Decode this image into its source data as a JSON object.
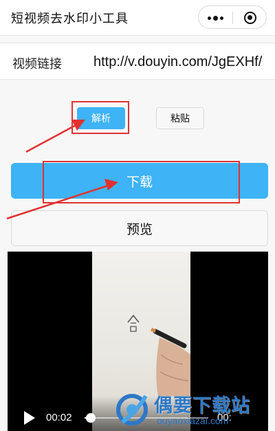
{
  "window": {
    "title": "短视频去水印小工具"
  },
  "capsule": {
    "more_icon": "more-dots-icon",
    "close_icon": "target-close-icon"
  },
  "link_row": {
    "label": "视频链接",
    "value": "http://v.douyin.com/JgEXHf/"
  },
  "buttons": {
    "parse": "解析",
    "paste": "粘贴",
    "download": "下载",
    "preview": "预览"
  },
  "video": {
    "current_time": "00:02",
    "total_time": "00:",
    "progress_fraction": 0.05
  },
  "watermark": {
    "title": "偶要下载站",
    "url": "ouyaoxiazai.com"
  },
  "colors": {
    "accent": "#3eb3f5",
    "annotation": "#e03131",
    "watermark": "#2e78c6"
  }
}
